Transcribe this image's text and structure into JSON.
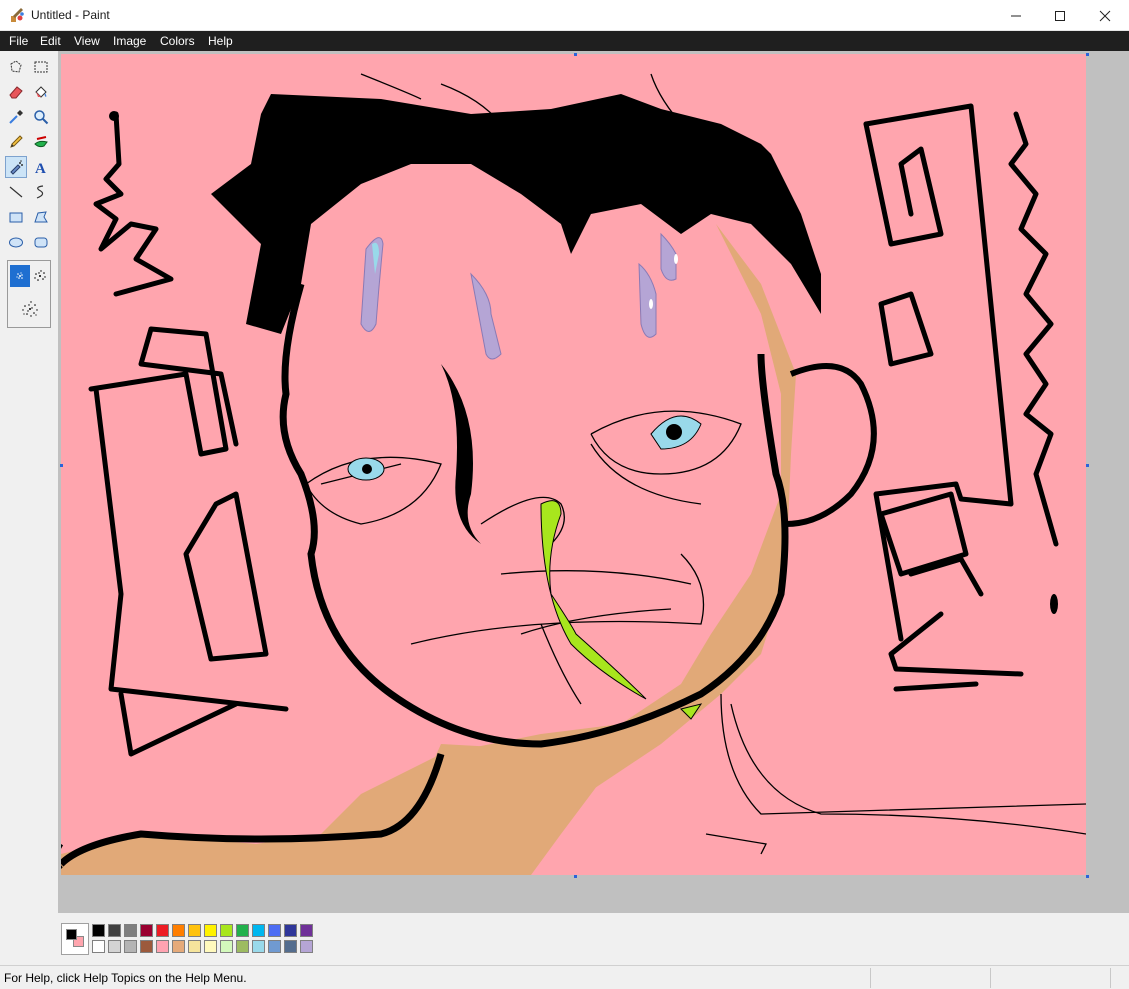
{
  "window": {
    "title": "Untitled - Paint"
  },
  "menu": {
    "items": [
      "File",
      "Edit",
      "View",
      "Image",
      "Colors",
      "Help"
    ]
  },
  "tools": [
    {
      "name": "free-form-select",
      "icon": "free-form-select-icon"
    },
    {
      "name": "select",
      "icon": "rect-select-icon"
    },
    {
      "name": "eraser",
      "icon": "eraser-icon"
    },
    {
      "name": "fill",
      "icon": "fill-bucket-icon"
    },
    {
      "name": "pick-color",
      "icon": "eyedropper-icon"
    },
    {
      "name": "magnifier",
      "icon": "magnifier-icon"
    },
    {
      "name": "pencil",
      "icon": "pencil-icon"
    },
    {
      "name": "brush",
      "icon": "brush-icon"
    },
    {
      "name": "airbrush",
      "icon": "airbrush-icon",
      "selected": true
    },
    {
      "name": "text",
      "icon": "text-icon"
    },
    {
      "name": "line",
      "icon": "line-icon"
    },
    {
      "name": "curve",
      "icon": "curve-icon"
    },
    {
      "name": "rectangle",
      "icon": "rectangle-icon"
    },
    {
      "name": "polygon",
      "icon": "polygon-icon"
    },
    {
      "name": "ellipse",
      "icon": "ellipse-icon"
    },
    {
      "name": "rounded-rectangle",
      "icon": "rounded-rectangle-icon"
    }
  ],
  "tool_options": [
    "airbrush-small",
    "airbrush-medium",
    "airbrush-large"
  ],
  "colors": {
    "foreground": "#000000",
    "background": "#ffa5ae",
    "palette_top": [
      "#000000",
      "#404040",
      "#7f7f7f",
      "#990030",
      "#ed1c24",
      "#ff7e00",
      "#ffc20e",
      "#fff200",
      "#a8e61d",
      "#22b14c",
      "#00b7ef",
      "#4d6df3",
      "#2f3699",
      "#6f3198"
    ],
    "palette_bottom": [
      "#ffffff",
      "#d3d3d3",
      "#b4b4b4",
      "#9c5a3c",
      "#ffa3b1",
      "#e5aa7a",
      "#f5e49c",
      "#fff9bd",
      "#d3f9bc",
      "#9dbb61",
      "#99d9ea",
      "#709ad1",
      "#546d8e",
      "#b5a5d5"
    ]
  },
  "drawing_colors": {
    "background": "#ffa5ae",
    "skin_shadow": "#e1a978",
    "ink": "#000000",
    "eye": "#99d9ea",
    "sweat": "#b5a5d5",
    "sweat_highlight": "#99d9ea",
    "slime": "#a8e61d"
  },
  "status": {
    "help_text": "For Help, click Help Topics on the Help Menu."
  }
}
